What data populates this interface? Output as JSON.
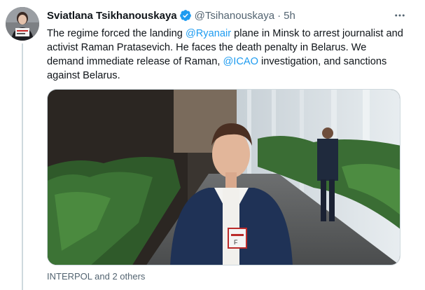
{
  "author": {
    "name": "Sviatlana Tsikhanouskaya",
    "handle": "@Tsihanouskaya",
    "separator": "·",
    "time": "5h",
    "verified": true
  },
  "tweet": {
    "text_1": "The regime forced the landing ",
    "mention_1": "@Ryanair",
    "text_2": " plane in Minsk to arrest journalist and activist Raman Pratasevich. He faces the death penalty in Belarus. We demand immediate release of Raman, ",
    "mention_2": "@ICAO",
    "text_3": " investigation, and sanctions against Belarus."
  },
  "media": {
    "description_icon": "photo",
    "badge_text": "F"
  },
  "tagged": {
    "text": "INTERPOL and 2 others"
  },
  "icons": {
    "more": "more-dots-icon",
    "verified": "verified-badge-icon"
  },
  "colors": {
    "accent": "#1d9bf0",
    "secondary_text": "#536471",
    "primary_text": "#0f1419",
    "border": "#cfd9de"
  }
}
